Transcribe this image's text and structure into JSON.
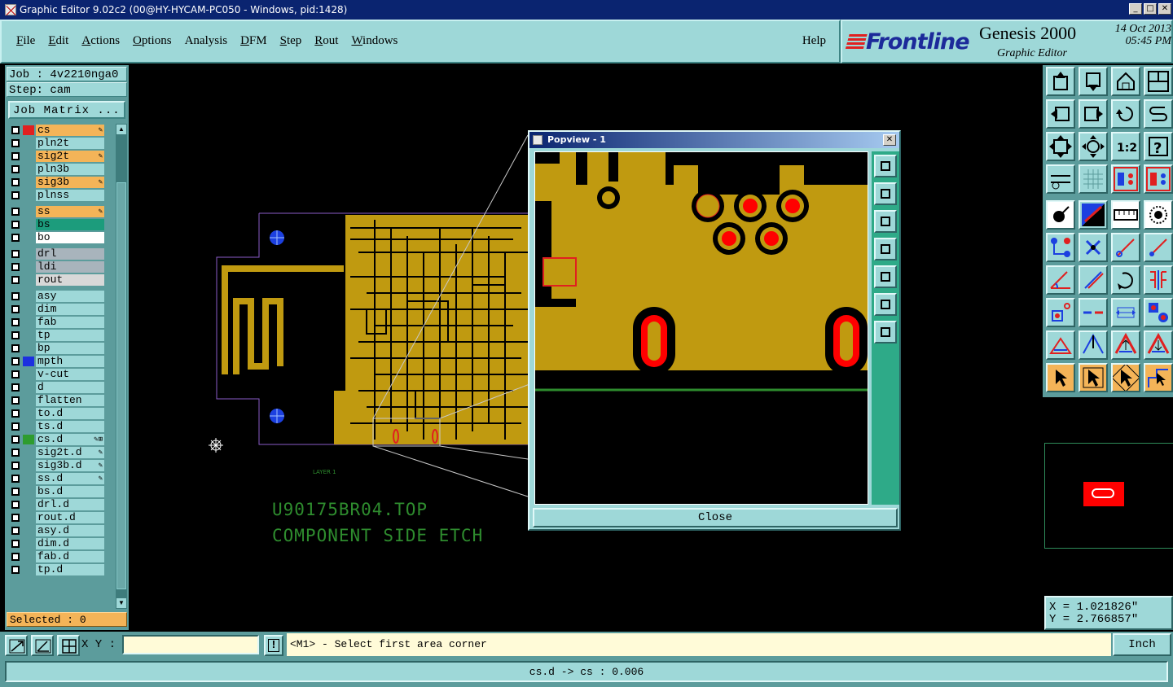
{
  "window": {
    "title": "Graphic Editor 9.02c2 (00@HY-HYCAM-PC050 - Windows, pid:1428)",
    "min": "_",
    "max": "□",
    "close": "✕"
  },
  "menu": {
    "items": [
      {
        "u": "F",
        "rest": "ile"
      },
      {
        "u": "E",
        "rest": "dit"
      },
      {
        "u": "A",
        "rest": "ctions"
      },
      {
        "u": "O",
        "rest": "ptions"
      },
      {
        "u": "",
        "rest": "Analysis"
      },
      {
        "u": "D",
        "rest": "FM"
      },
      {
        "u": "S",
        "rest": "tep"
      },
      {
        "u": "R",
        "rest": "out"
      },
      {
        "u": "W",
        "rest": "indows"
      }
    ],
    "help": "Help"
  },
  "brand": {
    "logo": "Frontline",
    "product": "Genesis 2000",
    "subtitle": "Graphic Editor",
    "date": "14 Oct 2013",
    "time": "05:45 PM"
  },
  "job": {
    "job_line": "Job : 4v2210nga0",
    "step_line": "Step: cam",
    "matrix_button": "Job Matrix ..."
  },
  "layers": [
    {
      "name": "cs",
      "style": "orange",
      "swatch": "#e02020",
      "flag": "✎"
    },
    {
      "name": "pln2t",
      "style": "",
      "swatch": "",
      "flag": ""
    },
    {
      "name": "sig2t",
      "style": "orange",
      "swatch": "",
      "flag": "✎"
    },
    {
      "name": "pln3b",
      "style": "",
      "swatch": "",
      "flag": ""
    },
    {
      "name": "sig3b",
      "style": "orange",
      "swatch": "",
      "flag": "✎"
    },
    {
      "name": "plnss",
      "style": "",
      "swatch": "",
      "flag": ""
    },
    {
      "gap": true
    },
    {
      "name": "ss",
      "style": "orange",
      "swatch": "",
      "flag": "✎"
    },
    {
      "name": "bs",
      "style": "green",
      "swatch": "",
      "flag": ""
    },
    {
      "name": "bo",
      "style": "white",
      "swatch": "",
      "flag": ""
    },
    {
      "gap": true
    },
    {
      "name": "drl",
      "style": "gray",
      "swatch": "",
      "flag": ""
    },
    {
      "name": "ldi",
      "style": "gray",
      "swatch": "",
      "flag": ""
    },
    {
      "name": "rout",
      "style": "lgray",
      "swatch": "",
      "flag": ""
    },
    {
      "gap": true
    },
    {
      "name": "asy",
      "style": "",
      "swatch": "",
      "flag": ""
    },
    {
      "name": "dim",
      "style": "",
      "swatch": "",
      "flag": ""
    },
    {
      "name": "fab",
      "style": "",
      "swatch": "",
      "flag": ""
    },
    {
      "name": "tp",
      "style": "",
      "swatch": "",
      "flag": ""
    },
    {
      "name": "bp",
      "style": "",
      "swatch": "",
      "flag": ""
    },
    {
      "name": "mpth",
      "style": "",
      "swatch": "#1c30e0",
      "flag": ""
    },
    {
      "name": "v-cut",
      "style": "",
      "swatch": "",
      "flag": ""
    },
    {
      "name": "d",
      "style": "",
      "swatch": "",
      "flag": ""
    },
    {
      "name": "flatten",
      "style": "",
      "swatch": "",
      "flag": ""
    },
    {
      "name": "to.d",
      "style": "",
      "swatch": "",
      "flag": ""
    },
    {
      "name": "ts.d",
      "style": "",
      "swatch": "",
      "flag": ""
    },
    {
      "name": "cs.d",
      "style": "",
      "swatch": "#2e9c2e",
      "flag": "✎⊞"
    },
    {
      "name": "sig2t.d",
      "style": "",
      "swatch": "",
      "flag": "✎"
    },
    {
      "name": "sig3b.d",
      "style": "",
      "swatch": "",
      "flag": "✎"
    },
    {
      "name": "ss.d",
      "style": "",
      "swatch": "",
      "flag": "✎"
    },
    {
      "name": "bs.d",
      "style": "",
      "swatch": "",
      "flag": ""
    },
    {
      "name": "drl.d",
      "style": "",
      "swatch": "",
      "flag": ""
    },
    {
      "name": "rout.d",
      "style": "",
      "swatch": "",
      "flag": ""
    },
    {
      "name": "asy.d",
      "style": "",
      "swatch": "",
      "flag": ""
    },
    {
      "name": "dim.d",
      "style": "",
      "swatch": "",
      "flag": ""
    },
    {
      "name": "fab.d",
      "style": "",
      "swatch": "",
      "flag": ""
    },
    {
      "name": "tp.d",
      "style": "",
      "swatch": "",
      "flag": ""
    }
  ],
  "selected": "Selected : 0",
  "canvas": {
    "etch_line1": "U90175BR04.TOP",
    "etch_line2": "COMPONENT SIDE ETCH",
    "layer_label": "LAYER 1"
  },
  "popview": {
    "title": "Popview - 1",
    "close_button": "Close"
  },
  "coords": {
    "x": "X = 1.021826\"",
    "y": "Y = 2.766857\""
  },
  "command": {
    "xy_label": "X Y :",
    "xy_value": "",
    "bang": "!",
    "prompt": "<M1> - Select first area corner",
    "unit": "Inch"
  },
  "status": "cs.d -> cs : 0.006",
  "colors": {
    "panel": "#9ed8d8",
    "copper": "#c09a10",
    "pad_red": "#ff0000",
    "etch_text": "#2e8c2e"
  }
}
